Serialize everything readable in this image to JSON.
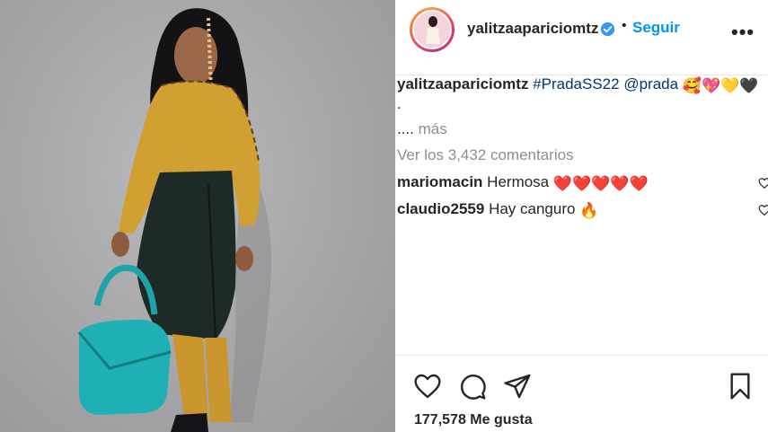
{
  "post": {
    "username": "yalitzaapariciomtz",
    "follow_label": "Seguir",
    "separator": "•",
    "more_label": "•••"
  },
  "caption": {
    "username": "yalitzaapariciomtz",
    "hashtag": "#PradaSS22",
    "mention": "@prada",
    "emojis": "🥰💖💛🖤",
    "line2": ".",
    "line3_prefix": "....",
    "line3_more": "más"
  },
  "view_comments": "Ver los 3,432 comentarios",
  "comments": [
    {
      "username": "mariomacin",
      "text": "Hermosa",
      "emoji": "❤️❤️❤️❤️❤️"
    },
    {
      "username": "claudio2559",
      "text": "Hay canguro",
      "emoji": "🔥"
    }
  ],
  "likes": "177,578 Me gusta",
  "icons": [
    "verified-icon",
    "heart-icon",
    "comment-icon",
    "share-icon",
    "bookmark-icon"
  ],
  "colors": {
    "accent": "#0095f6",
    "text": "#262626",
    "muted": "#8e8e8e",
    "tag": "#00376b"
  }
}
